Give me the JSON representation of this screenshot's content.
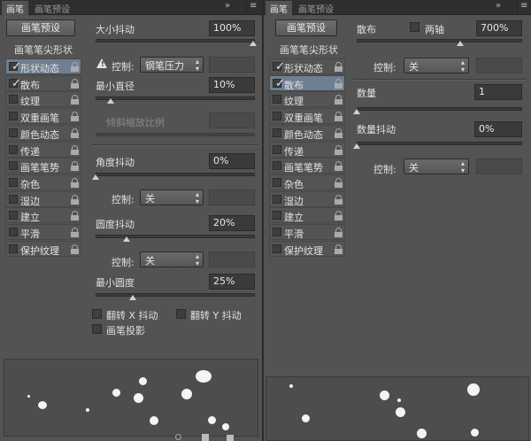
{
  "panelA": {
    "tabs": [
      "画笔",
      "画笔预设"
    ],
    "preset_button": "画笔预设",
    "list_header": "画笔笔尖形状",
    "items": [
      {
        "label": "形状动态",
        "checked": true,
        "selected": true
      },
      {
        "label": "散布",
        "checked": true,
        "selected": false
      },
      {
        "label": "纹理",
        "checked": false,
        "selected": false
      },
      {
        "label": "双重画笔",
        "checked": false,
        "selected": false
      },
      {
        "label": "颜色动态",
        "checked": false,
        "selected": false
      },
      {
        "label": "传递",
        "checked": false,
        "selected": false
      },
      {
        "label": "画笔笔势",
        "checked": false,
        "selected": false
      },
      {
        "label": "杂色",
        "checked": false,
        "selected": false
      },
      {
        "label": "湿边",
        "checked": false,
        "selected": false
      },
      {
        "label": "建立",
        "checked": false,
        "selected": false
      },
      {
        "label": "平滑",
        "checked": false,
        "selected": false
      },
      {
        "label": "保护纹理",
        "checked": false,
        "selected": false
      }
    ],
    "size_jitter": {
      "label": "大小抖动",
      "value": "100%"
    },
    "control1": {
      "label": "控制:",
      "value": "钢笔压力"
    },
    "min_diameter": {
      "label": "最小直径",
      "value": "10%"
    },
    "tilt_scale": {
      "label": "倾斜缩放比例"
    },
    "angle_jitter": {
      "label": "角度抖动",
      "value": "0%"
    },
    "control2": {
      "label": "控制:",
      "value": "关"
    },
    "round_jitter": {
      "label": "圆度抖动",
      "value": "20%"
    },
    "control3": {
      "label": "控制:",
      "value": "关"
    },
    "min_round": {
      "label": "最小圆度",
      "value": "25%"
    },
    "flip_x": "翻转 X 抖动",
    "flip_y": "翻转 Y 抖动",
    "brush_proj": "画笔投影"
  },
  "panelB": {
    "tabs": [
      "画笔",
      "画笔预设"
    ],
    "preset_button": "画笔预设",
    "list_header": "画笔笔尖形状",
    "items": [
      {
        "label": "形状动态",
        "checked": true,
        "selected": false
      },
      {
        "label": "散布",
        "checked": true,
        "selected": true
      },
      {
        "label": "纹理",
        "checked": false,
        "selected": false
      },
      {
        "label": "双重画笔",
        "checked": false,
        "selected": false
      },
      {
        "label": "颜色动态",
        "checked": false,
        "selected": false
      },
      {
        "label": "传递",
        "checked": false,
        "selected": false
      },
      {
        "label": "画笔笔势",
        "checked": false,
        "selected": false
      },
      {
        "label": "杂色",
        "checked": false,
        "selected": false
      },
      {
        "label": "湿边",
        "checked": false,
        "selected": false
      },
      {
        "label": "建立",
        "checked": false,
        "selected": false
      },
      {
        "label": "平滑",
        "checked": false,
        "selected": false
      },
      {
        "label": "保护纹理",
        "checked": false,
        "selected": false
      }
    ],
    "scatter": {
      "label": "散布",
      "both_axes": "两轴",
      "value": "700%"
    },
    "control1": {
      "label": "控制:",
      "value": "关"
    },
    "count": {
      "label": "数量",
      "value": "1"
    },
    "count_jitter": {
      "label": "数量抖动",
      "value": "0%"
    },
    "control2": {
      "label": "控制:",
      "value": "关"
    }
  },
  "icons": {
    "double_arrow": "»",
    "menu": "≡"
  },
  "colors": {
    "panel": "#535353",
    "selected": "#6e7f91",
    "tabbar": "#2f2f2f"
  }
}
